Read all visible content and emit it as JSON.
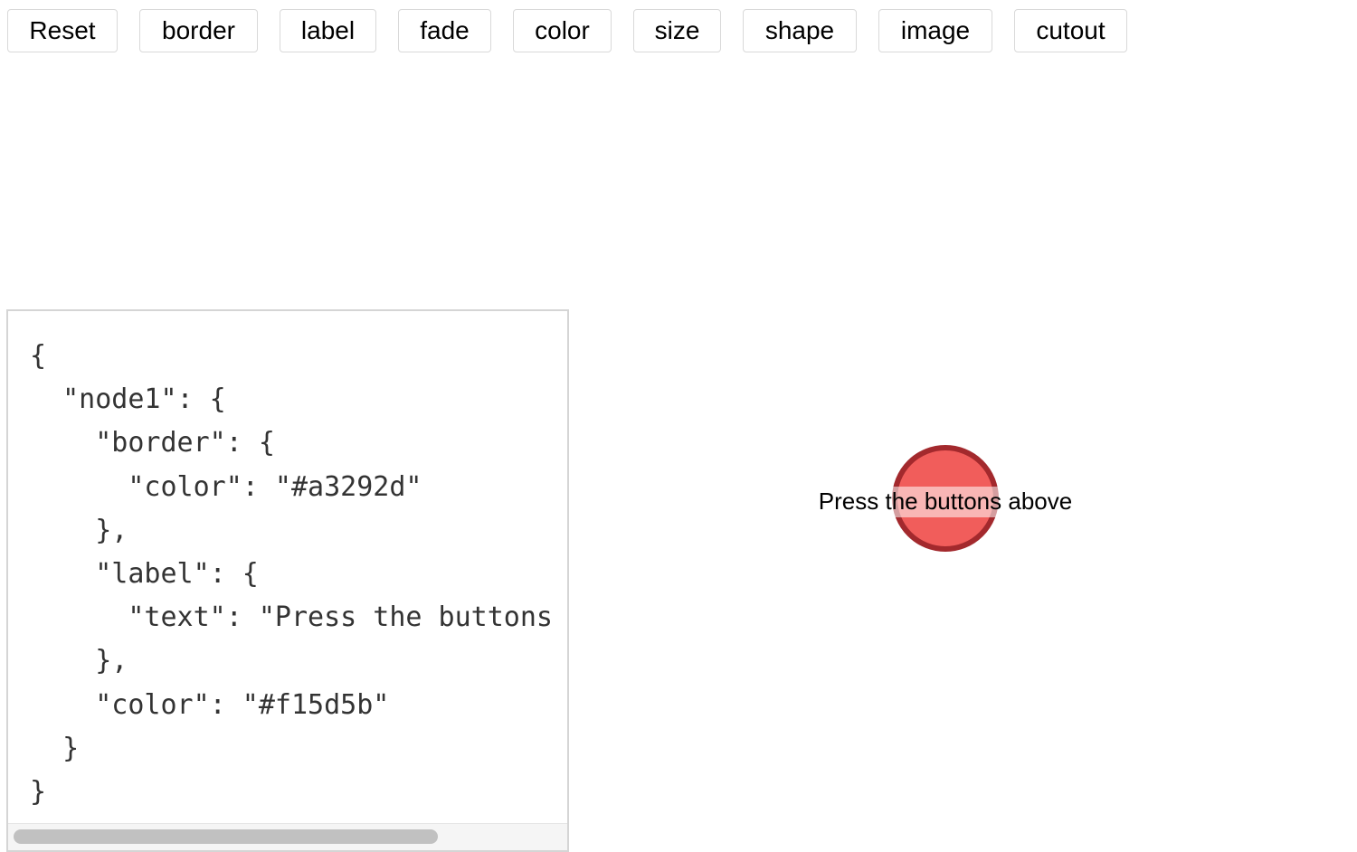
{
  "toolbar": {
    "buttons": [
      {
        "label": "Reset"
      },
      {
        "label": "border"
      },
      {
        "label": "label"
      },
      {
        "label": "fade"
      },
      {
        "label": "color"
      },
      {
        "label": "size"
      },
      {
        "label": "shape"
      },
      {
        "label": "image"
      },
      {
        "label": "cutout"
      }
    ]
  },
  "json_panel": {
    "lines": [
      "{",
      "  \"node1\": {",
      "    \"border\": {",
      "      \"color\": \"#a3292d\"",
      "    },",
      "    \"label\": {",
      "      \"text\": \"Press the buttons above\"",
      "    },",
      "    \"color\": \"#f15d5b\"",
      "  }",
      "}"
    ]
  },
  "graph": {
    "node1": {
      "label": "Press the buttons above",
      "color": "#f15d5b",
      "border_color": "#a3292d"
    }
  }
}
